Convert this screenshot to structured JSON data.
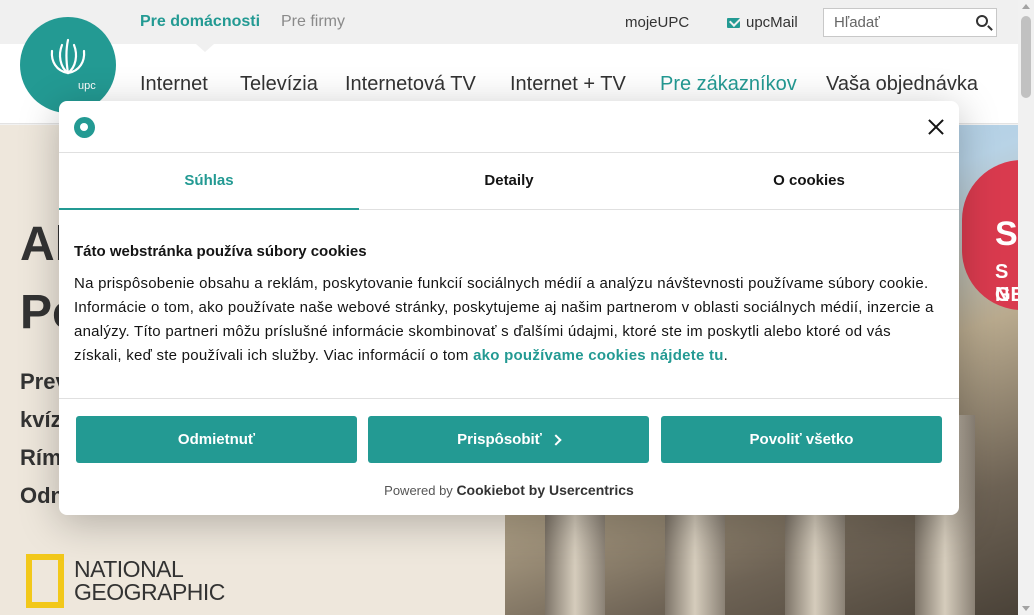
{
  "topbar": {
    "segment_home": "Pre domácnosti",
    "segment_business": "Pre firmy",
    "link_moje": "mojeUPC",
    "link_mail": "upcMail",
    "search_placeholder": "Hľadať"
  },
  "logo": {
    "text": "upc"
  },
  "nav": {
    "items": [
      "Internet",
      "Televízia",
      "Internetová TV",
      "Internet + TV",
      "Pre zákazníkov",
      "Vaša objednávka"
    ],
    "active_color": "#239a93"
  },
  "hero": {
    "heading_line1": "Al",
    "heading_line2": "Po",
    "sub_lines": [
      "Prev",
      "kvíz",
      "Rím",
      "Odn"
    ],
    "badge_lines": [
      "S",
      "S N",
      "GE"
    ],
    "ng_line1": "NATIONAL",
    "ng_line2": "GEOGRAPHIC"
  },
  "dialog": {
    "tabs": [
      "Súhlas",
      "Detaily",
      "O cookies"
    ],
    "active_tab": 0,
    "title": "Táto webstránka používa súbory cookies",
    "text": "Na prispôsobenie obsahu a reklám, poskytovanie funkcií sociálnych médií a analýzu návštevnosti používame súbory cookie. Informácie o tom, ako používate naše webové stránky, poskytujeme aj našim partnerom v oblasti sociálnych médií, inzercie a analýzy. Títo partneri môžu príslušné informácie skombinovať s ďalšími údajmi, ktoré ste im poskytli alebo ktoré od vás získali, keď ste používali ich služby. Viac informácií o tom ",
    "link_text": "ako používame cookies nájdete tu",
    "text_end": ".",
    "buttons": {
      "reject": "Odmietnuť",
      "customize": "Prispôsobiť",
      "allow": "Povoliť všetko"
    },
    "powered_prefix": "Powered by",
    "powered_brand": "Cookiebot by Usercentrics"
  },
  "colors": {
    "accent": "#239a93",
    "badge": "#d93a4e",
    "ng_yellow": "#f2c81a"
  }
}
